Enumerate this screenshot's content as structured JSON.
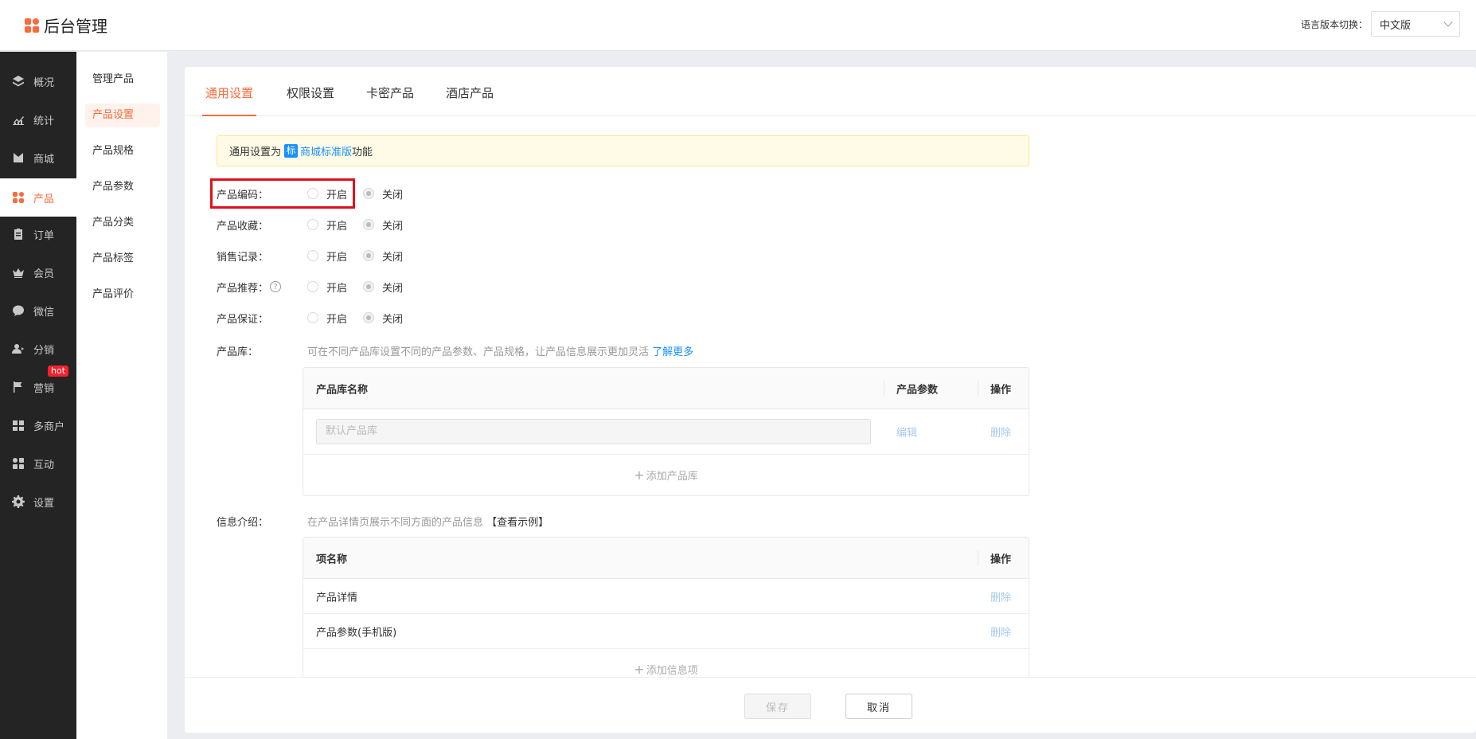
{
  "header": {
    "app_title": "后台管理",
    "lang_label": "语言版本切换：",
    "lang_value": "中文版"
  },
  "nav": {
    "items": [
      {
        "label": "概况",
        "icon": "layers-icon"
      },
      {
        "label": "统计",
        "icon": "chart-icon"
      },
      {
        "label": "商城",
        "icon": "shop-icon"
      },
      {
        "label": "产品",
        "icon": "grid-icon",
        "active": true
      },
      {
        "label": "订单",
        "icon": "clipboard-icon"
      },
      {
        "label": "会员",
        "icon": "crown-icon"
      },
      {
        "label": "微信",
        "icon": "wechat-icon"
      },
      {
        "label": "分销",
        "icon": "user-share-icon"
      },
      {
        "label": "营销",
        "icon": "flag-icon",
        "badge": "hot"
      },
      {
        "label": "多商户",
        "icon": "store-icon"
      },
      {
        "label": "互动",
        "icon": "people-icon"
      },
      {
        "label": "设置",
        "icon": "gear-icon"
      }
    ]
  },
  "subnav": {
    "items": [
      "管理产品",
      "产品设置",
      "产品规格",
      "产品参数",
      "产品分类",
      "产品标签",
      "产品评价"
    ],
    "active": "产品设置"
  },
  "tabs": [
    "通用设置",
    "权限设置",
    "卡密产品",
    "酒店产品"
  ],
  "notice": {
    "prefix": "通用设置为",
    "badge": "标",
    "link": "商城标准版",
    "suffix": "功能"
  },
  "settings": [
    {
      "label": "产品编码：",
      "on": "开启",
      "off": "关闭",
      "value": "关闭"
    },
    {
      "label": "产品收藏：",
      "on": "开启",
      "off": "关闭",
      "value": "关闭"
    },
    {
      "label": "销售记录：",
      "on": "开启",
      "off": "关闭",
      "value": "关闭"
    },
    {
      "label": "产品推荐：",
      "on": "开启",
      "off": "关闭",
      "value": "关闭",
      "help": "?"
    },
    {
      "label": "产品保证：",
      "on": "开启",
      "off": "关闭",
      "value": "关闭"
    }
  ],
  "library": {
    "label": "产品库：",
    "desc": "可在不同产品库设置不同的产品参数、产品规格，让产品信息展示更加灵活",
    "more": "了解更多",
    "columns": [
      "产品库名称",
      "产品参数",
      "操作"
    ],
    "rows": [
      {
        "placeholder": "默认产品库",
        "edit": "编辑",
        "delete": "删除"
      }
    ],
    "add": "添加产品库"
  },
  "info": {
    "label": "信息介绍：",
    "desc": "在产品详情页展示不同方面的产品信息",
    "example": "【查看示例】",
    "columns": [
      "项名称",
      "操作"
    ],
    "rows": [
      {
        "name": "产品详情",
        "delete": "删除"
      },
      {
        "name": "产品参数(手机版)",
        "delete": "删除"
      }
    ],
    "add": "添加信息项"
  },
  "footer": {
    "save": "保存",
    "cancel": "取消"
  }
}
